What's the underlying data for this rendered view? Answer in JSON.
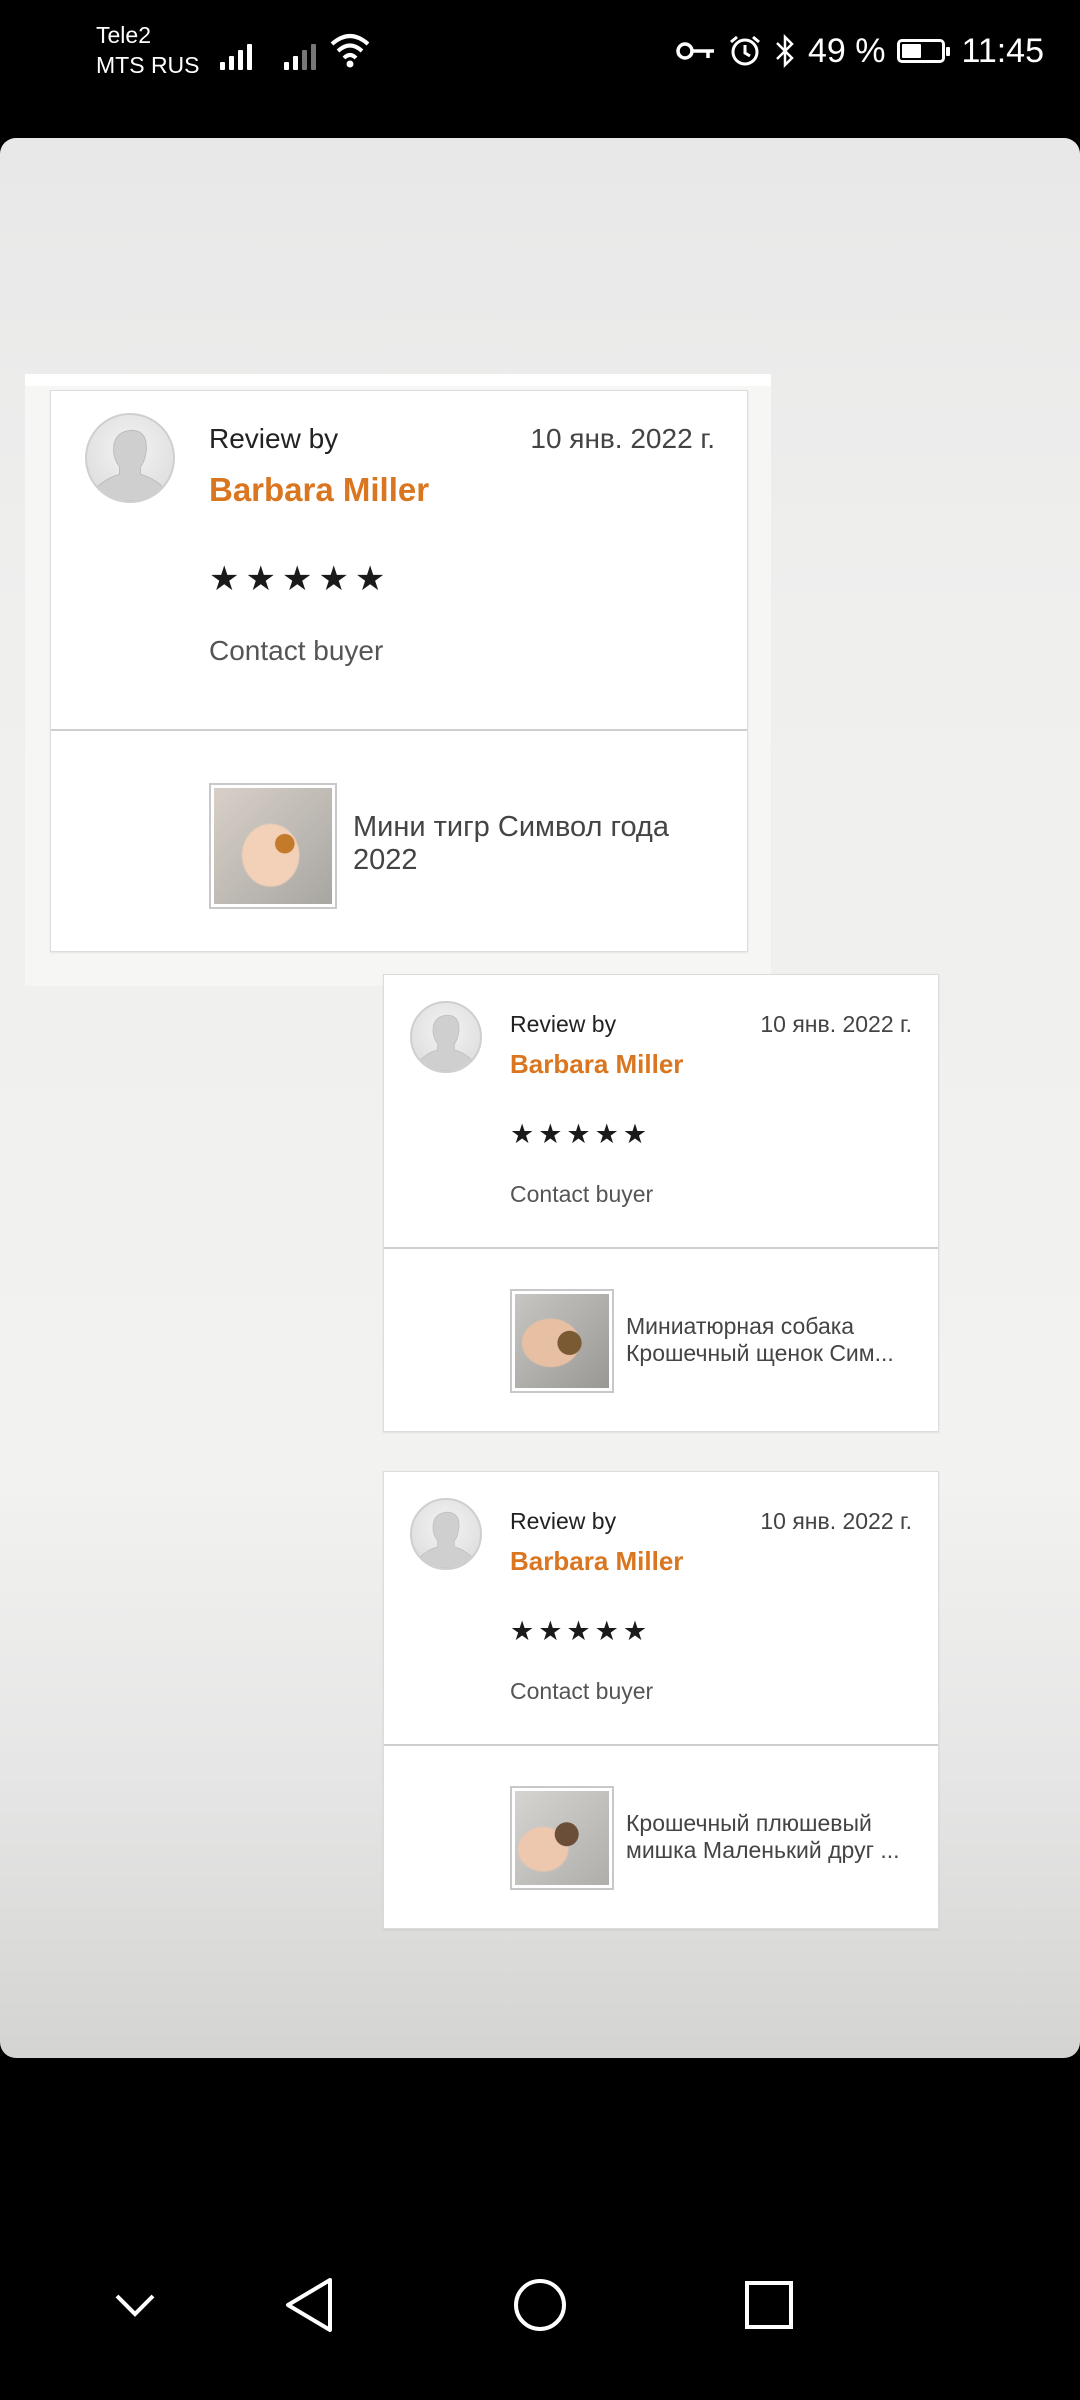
{
  "status_bar": {
    "carrier1": "Tele2",
    "carrier2": "MTS RUS",
    "battery_text": "49 %",
    "battery_level": 0.49,
    "time": "11:45",
    "icons": [
      "signal-icon",
      "signal-icon",
      "wifi-icon",
      "key-icon",
      "alarm-icon",
      "bluetooth-icon",
      "battery-icon"
    ]
  },
  "reviews": [
    {
      "review_by": "Review by",
      "date": "10 янв. 2022 г.",
      "name": "Barbara Miller",
      "stars": "★★★★★",
      "rating": 5,
      "contact": "Contact buyer",
      "product": "Мини тигр Символ года 2022"
    },
    {
      "review_by": "Review by",
      "date": "10 янв. 2022 г.",
      "name": "Barbara Miller",
      "stars": "★★★★★",
      "rating": 5,
      "contact": "Contact buyer",
      "product_line1": "Миниатюрная собака",
      "product_line2": "Крошечный щенок Сим..."
    },
    {
      "review_by": "Review by",
      "date": "10 янв. 2022 г.",
      "name": "Barbara Miller",
      "stars": "★★★★★",
      "rating": 5,
      "contact": "Contact buyer",
      "product_line1": "Крошечный плюшевый",
      "product_line2": "мишка Маленький друг ..."
    }
  ],
  "nav": {
    "icons": [
      "chevron-down-icon",
      "back-icon",
      "home-icon",
      "recents-icon"
    ]
  },
  "colors": {
    "accent_name": "#d9761f",
    "background": "#000000"
  }
}
